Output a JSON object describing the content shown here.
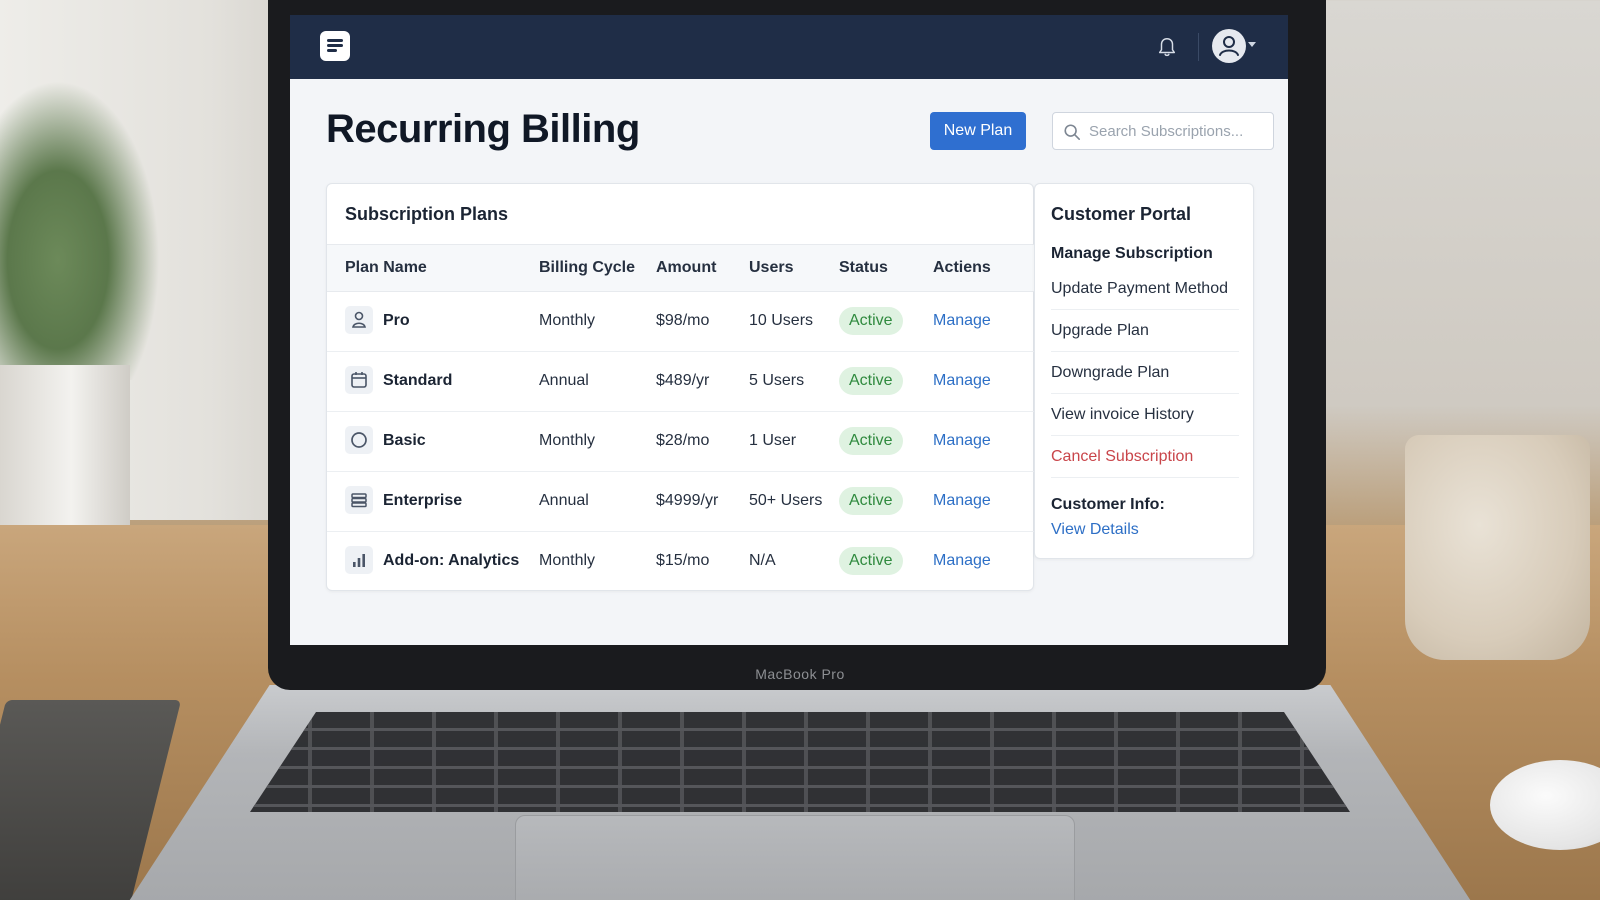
{
  "device": {
    "brand": "MacBook Pro"
  },
  "page": {
    "title": "Recurring Billing"
  },
  "toolbar": {
    "new_plan_label": "New Plan",
    "search_placeholder": "Search Subscriptions...",
    "search_value": ""
  },
  "plans": {
    "title": "Subscription Plans",
    "columns": [
      "Plan Name",
      "Billing Cycle",
      "Amount",
      "Users",
      "Status",
      "Actiens"
    ],
    "rows": [
      {
        "icon": "user-icon",
        "name": "Pro",
        "cycle": "Monthly",
        "amount": "$98/mo",
        "users": "10 Users",
        "status": "Active",
        "action": "Manage"
      },
      {
        "icon": "calendar-icon",
        "name": "Standard",
        "cycle": "Annual",
        "amount": "$489/yr",
        "users": "5 Users",
        "status": "Active",
        "action": "Manage"
      },
      {
        "icon": "circle-icon",
        "name": "Basic",
        "cycle": "Monthly",
        "amount": "$28/mo",
        "users": "1 User",
        "status": "Active",
        "action": "Manage"
      },
      {
        "icon": "server-stack-icon",
        "name": "Enterprise",
        "cycle": "Annual",
        "amount": "$4999/yr",
        "users": "50+ Users",
        "status": "Active",
        "action": "Manage"
      },
      {
        "icon": "bar-chart-icon",
        "name": "Add-on: Analytics",
        "cycle": "Monthly",
        "amount": "$15/mo",
        "users": "N/A",
        "status": "Active",
        "action": "Manage"
      }
    ]
  },
  "portal": {
    "title": "Customer Portal",
    "subtitle": "Manage Subscription",
    "items": [
      {
        "label": "Update Payment Method"
      },
      {
        "label": "Upgrade Plan"
      },
      {
        "label": "Downgrade Plan"
      },
      {
        "label": "View invoice History"
      },
      {
        "label": "Cancel Subscription"
      }
    ],
    "info_label": "Customer Info:",
    "info_link": "View Details"
  },
  "colors": {
    "topbar": "#1f2d47",
    "primary": "#2f6fd0",
    "link": "#2d6fc6",
    "success_bg": "#dff2e1",
    "success_text": "#2f8a3e",
    "danger": "#c9454a"
  },
  "icons": {
    "logo": "document-lines-icon",
    "notifications": "bell-icon",
    "profile": "user-avatar-icon",
    "search": "search-icon"
  }
}
